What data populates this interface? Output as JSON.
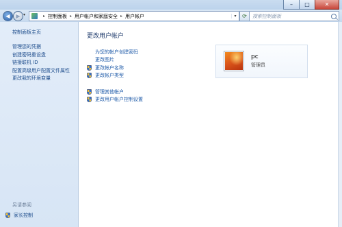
{
  "window": {
    "buttons": {
      "minimize": "–",
      "maximize": "□",
      "close": "✕"
    }
  },
  "address_bar": {
    "breadcrumbs": [
      "控制面板",
      "用户帐户和家庭安全",
      "用户帐户"
    ]
  },
  "search": {
    "placeholder": "搜索控制面板"
  },
  "sidebar": {
    "home": "控制面板主页",
    "links": [
      "管理您的凭据",
      "创建密码重设盘",
      "链接联机 ID",
      "配置高级用户配置文件属性",
      "更改我的环境变量"
    ],
    "see_also_header": "另请参阅",
    "see_also_items": [
      "家长控制"
    ]
  },
  "main": {
    "title": "更改用户帐户",
    "tasks_group1": [
      {
        "label": "为您的帐户创建密码",
        "shield": false
      },
      {
        "label": "更改图片",
        "shield": false
      },
      {
        "label": "更改帐户名称",
        "shield": true
      },
      {
        "label": "更改帐户类型",
        "shield": true
      }
    ],
    "tasks_group2": [
      {
        "label": "管理其他帐户",
        "shield": true
      },
      {
        "label": "更改用户帐户控制设置",
        "shield": true
      }
    ]
  },
  "user": {
    "name": "pc",
    "role": "管理员"
  },
  "colors": {
    "link": "#1e5aa8",
    "sidebar_bg": "#dfeaf7",
    "title": "#1e3a6b"
  }
}
